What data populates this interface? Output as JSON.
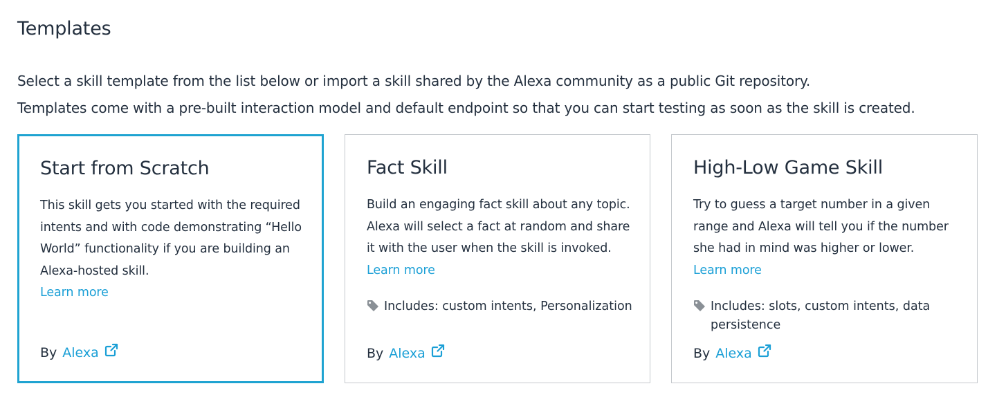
{
  "page": {
    "title": "Templates",
    "description_line1": "Select a skill template from the list below or import a skill shared by the Alexa community as a public Git repository.",
    "description_line2": "Templates come with a pre-built interaction model and default endpoint so that you can start testing as soon as the skill is created."
  },
  "colors": {
    "accent": "#1fa3d1",
    "link": "#1a9fd6",
    "text": "#232f3e",
    "card_border": "#c4c8cc",
    "icon_gray": "#8a9096"
  },
  "cards": [
    {
      "title": "Start from Scratch",
      "description": "This skill gets you started with the required intents and with code demonstrating “Hello World” functionality if you are building an Alexa-hosted skill.",
      "learn_more": "Learn more",
      "includes": "",
      "by_label": "By",
      "author": "Alexa",
      "author_icon": "external-link-icon",
      "selected": true
    },
    {
      "title": "Fact Skill",
      "description": "Build an engaging fact skill about any topic. Alexa will select a fact at random and share it with the user when the skill is invoked.",
      "learn_more": "Learn more",
      "includes_icon": "tag-icon",
      "includes": "Includes: custom intents, Personalization",
      "by_label": "By",
      "author": "Alexa",
      "author_icon": "external-link-icon",
      "selected": false
    },
    {
      "title": "High-Low Game Skill",
      "description": "Try to guess a target number in a given range and Alexa will tell you if the number she had in mind was higher or lower.",
      "learn_more": "Learn more",
      "includes_icon": "tag-icon",
      "includes": "Includes: slots, custom intents, data persistence",
      "by_label": "By",
      "author": "Alexa",
      "author_icon": "external-link-icon",
      "selected": false
    }
  ]
}
